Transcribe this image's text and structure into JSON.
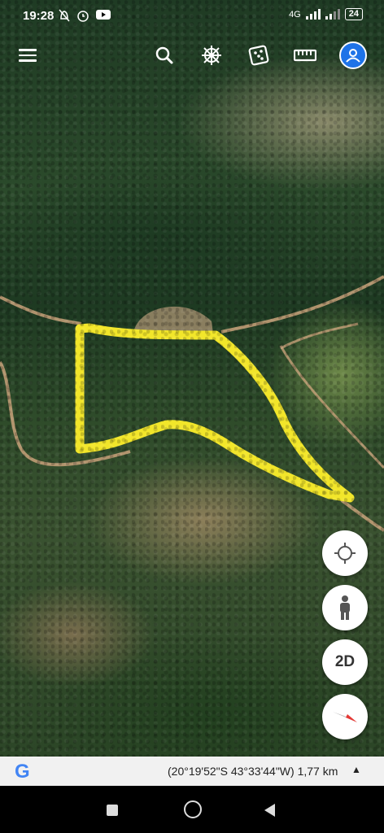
{
  "status": {
    "time": "19:28",
    "network": "4G",
    "battery": "24",
    "icons": [
      "do-not-disturb-icon",
      "alarm-icon",
      "youtube-icon",
      "signal-icon",
      "battery-icon"
    ]
  },
  "toolbar": {
    "icons": [
      "menu-icon",
      "search-icon",
      "voyager-icon",
      "feeling-lucky-dice-icon",
      "measure-ruler-icon",
      "account-avatar-icon"
    ]
  },
  "map_controls": {
    "view_mode_label": "2D",
    "icons": [
      "my-location-icon",
      "street-view-pegman-icon",
      "compass-icon"
    ]
  },
  "bottom_bar": {
    "logo_letter": "G",
    "coordinates": "(20°19'52\"S 43°33'44\"W) 1,77 km",
    "toggle_glyph": "▲"
  },
  "colors": {
    "polygon_outline": "#f2e62a",
    "road": "#c9a27a",
    "accent_blue": "#1e73e8",
    "google_blue": "#4285f4"
  }
}
